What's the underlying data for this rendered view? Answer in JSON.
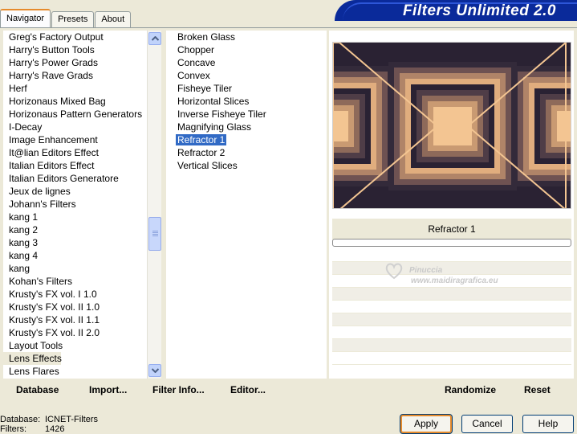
{
  "tabs": [
    {
      "label": "Navigator"
    },
    {
      "label": "Presets"
    },
    {
      "label": "About"
    }
  ],
  "banner_title": "Filters Unlimited 2.0",
  "categories": [
    "Greg's Factory Output",
    "Harry's Button Tools",
    "Harry's Power Grads",
    "Harry's Rave Grads",
    "Herf",
    "Horizonaus Mixed Bag",
    "Horizonaus Pattern Generators",
    "I-Decay",
    "Image Enhancement",
    "It@lian Editors Effect",
    "Italian Editors Effect",
    "Italian Editors Generatore",
    "Jeux de lignes",
    "Johann's Filters",
    "kang 1",
    "kang 2",
    "kang 3",
    "kang 4",
    "kang",
    "Kohan's Filters",
    "Krusty's FX vol. I 1.0",
    "Krusty's FX vol. II 1.0",
    "Krusty's FX vol. II 1.1",
    "Krusty's FX vol. II 2.0",
    "Layout Tools",
    "Lens Effects",
    "Lens Flares"
  ],
  "selected_category": "Lens Effects",
  "filters": [
    "Broken Glass",
    "Chopper",
    "Concave",
    "Convex",
    "Fisheye Tiler",
    "Horizontal Slices",
    "Inverse Fisheye Tiler",
    "Magnifying Glass",
    "Refractor 1",
    "Refractor 2",
    "Vertical Slices"
  ],
  "selected_filter": "Refractor 1",
  "preview_filter_name": "Refractor 1",
  "watermark": {
    "line1": "Pinuccia",
    "line2": "www.maidiragrafica.eu"
  },
  "bottom_links": {
    "database": "Database",
    "import": "Import...",
    "filter_info": "Filter Info...",
    "editor": "Editor...",
    "randomize": "Randomize",
    "reset": "Reset"
  },
  "status": {
    "database_label": "Database:",
    "database_value": "ICNET-Filters",
    "filters_label": "Filters:",
    "filters_value": "1426"
  },
  "buttons": {
    "apply": "Apply",
    "cancel": "Cancel",
    "help": "Help"
  },
  "colors": {
    "dialog_bg": "#ece9d8",
    "selection": "#316ac5",
    "banner": "#0a2a9a",
    "preview_dark": "#2a2233",
    "preview_light": "#f0c090"
  }
}
